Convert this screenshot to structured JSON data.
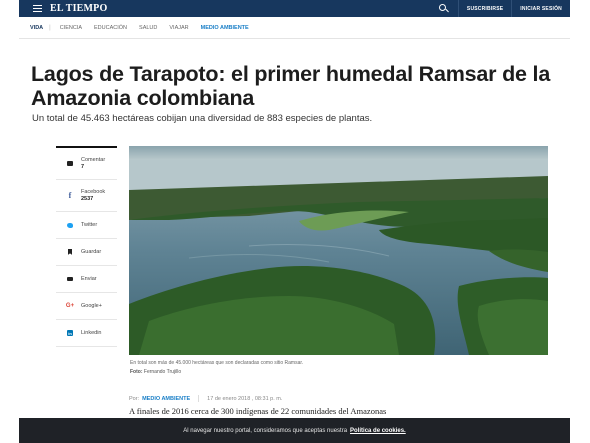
{
  "header": {
    "logo": "EL TIEMPO",
    "subscribe": "SUSCRIBIRSE",
    "login": "INICIAR SESIÓN",
    "brand_color": "#17375e"
  },
  "subnav": {
    "section": "VIDA",
    "items": [
      "CIENCIA",
      "EDUCACIÓN",
      "SALUD",
      "VIAJAR"
    ],
    "highlight": "MEDIO AMBIENTE"
  },
  "article": {
    "title": "Lagos de Tarapoto: el primer humedal Ramsar de la Amazonia colombiana",
    "subtitle": "Un total de 45.463 hectáreas cobijan una diversidad de 883 especies de plantas.",
    "caption": "En total son más de 45.000 hectáreas que son declaradas como sitio Ramsar.",
    "credit_label": "Foto:",
    "credit_name": "Fernando Trujillo",
    "by": "Por:",
    "category": "MEDIO AMBIENTE",
    "date": "17 de enero 2018 , 08:31 p. m.",
    "lead": "A finales de 2016 cerca de 300 indígenas de 22 comunidades del Amazonas"
  },
  "share": {
    "comment_label": "Comentar",
    "comment_count": "7",
    "facebook_label": "Facebook",
    "facebook_count": "2537",
    "twitter": "Twitter",
    "save": "Guardar",
    "send": "Enviar",
    "google": "Google+",
    "linkedin": "Linkedin"
  },
  "cookie": {
    "text": "Al navegar nuestro portal, consideramos que aceptas nuestra",
    "link": "Política de cookies."
  }
}
